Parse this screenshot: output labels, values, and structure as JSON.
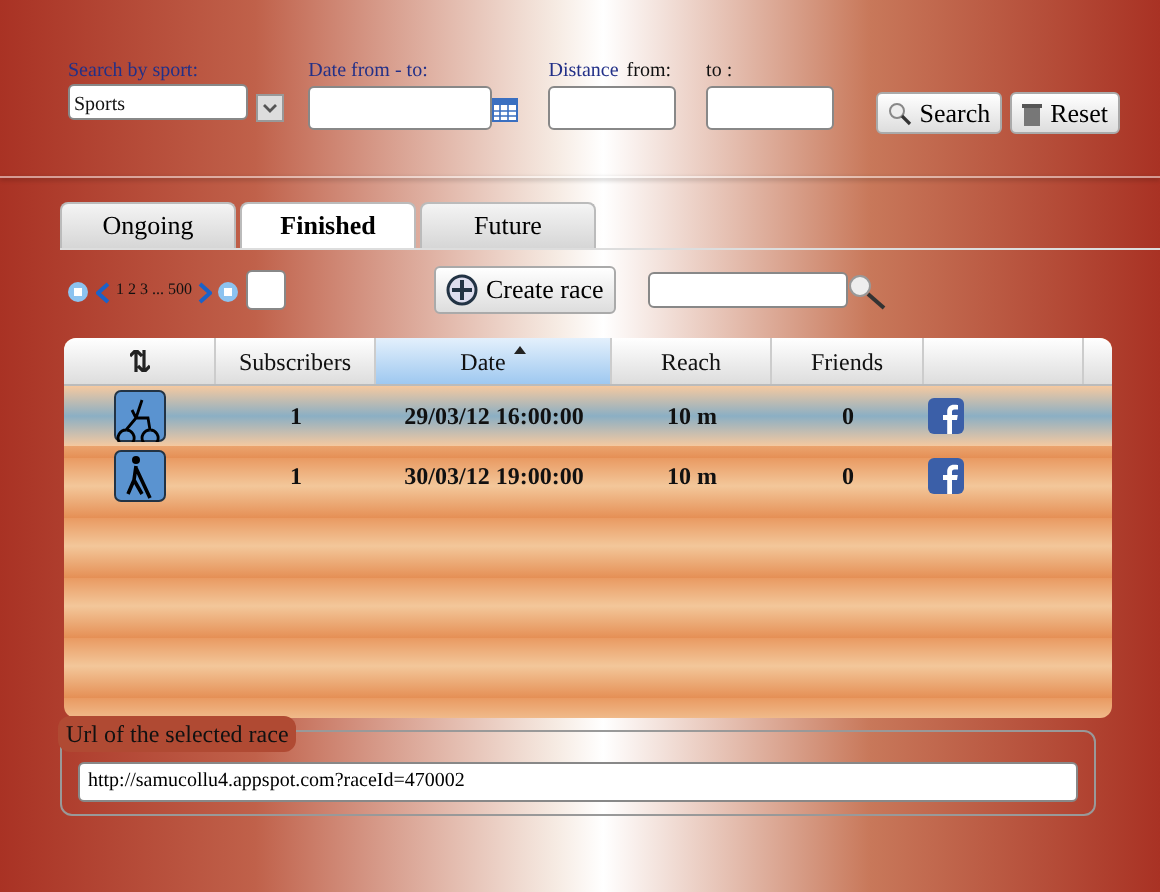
{
  "filters": {
    "sport": {
      "label": "Search by sport:",
      "value": "Sports"
    },
    "date": {
      "label": "Date from - to:"
    },
    "distance": {
      "label_1": "Distance",
      "label_2": "from:",
      "label_3": "to  :"
    },
    "buttons": [
      "Search",
      "Reset"
    ]
  },
  "tabs": [
    {
      "label": "Ongoing",
      "selected": false
    },
    {
      "label": "Finished",
      "selected": true
    },
    {
      "label": "Future",
      "selected": false
    }
  ],
  "pager": {
    "pages": "1 2 3 ... 500"
  },
  "create_button": "Create race",
  "table": {
    "columns": [
      {
        "label": "Subscribers",
        "sorted": false
      },
      {
        "label": "Date",
        "sorted": true
      },
      {
        "label": "Reach",
        "sorted": false
      },
      {
        "label": "Friends",
        "sorted": false
      }
    ],
    "rows": [
      {
        "kind": "bike",
        "subscribers": "1",
        "date": "29/03/12 16:00:00",
        "reach": "10 m",
        "friends": "0",
        "selected": true
      },
      {
        "kind": "walk",
        "subscribers": "1",
        "date": "30/03/12 19:00:00",
        "reach": "10 m",
        "friends": "0",
        "selected": false
      }
    ]
  },
  "url_box": {
    "legend": "Url of the selected race",
    "value": "http://samucollu4.appspot.com?raceId=470002"
  }
}
